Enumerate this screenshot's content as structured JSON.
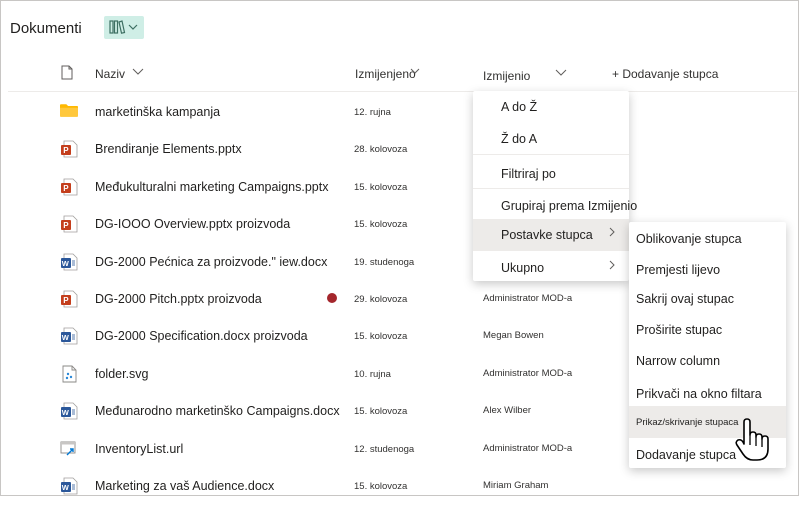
{
  "header": {
    "title": "Dokumenti"
  },
  "columns": {
    "name": "Naziv",
    "modified": "Izmijenjeno",
    "modified_by": "Izmijenio",
    "add_column": "+ Dodavanje stupca"
  },
  "rows": [
    {
      "name": "marketinška kampanja",
      "date": "12. rujna",
      "by": "",
      "icon": "folder-icon"
    },
    {
      "name": "Brendiranje Elements.pptx",
      "date": "28. kolovoza",
      "by": "",
      "icon": "powerpoint-icon"
    },
    {
      "name": "Međukulturalni marketing Campaigns.pptx",
      "date": "15. kolovoza",
      "by": "",
      "icon": "powerpoint-icon"
    },
    {
      "name": "DG-IOOO Overview.pptx proizvoda",
      "date": "15. kolovoza",
      "by": "",
      "icon": "powerpoint-icon"
    },
    {
      "name": "DG-2000 Pećnica za proizvode.\" iew.docx",
      "date": "19. studenoga",
      "by": "",
      "icon": "word-icon"
    },
    {
      "name": "DG-2000 Pitch.pptx proizvoda",
      "date": "29. kolovoza",
      "by": "Administrator MOD-a",
      "icon": "powerpoint-icon"
    },
    {
      "name": "DG-2000 Specification.docx proizvoda",
      "date": "15. kolovoza",
      "by": "Megan Bowen",
      "icon": "word-icon"
    },
    {
      "name": "folder.svg",
      "date": "10. rujna",
      "by": "Administrator MOD-a",
      "icon": "svg-file-icon"
    },
    {
      "name": "Međunarodno marketinško Campaigns.docx",
      "date": "15. kolovoza",
      "by": "Alex Wilber",
      "icon": "word-icon"
    },
    {
      "name": "InventoryList.url",
      "date": "12. studenoga",
      "by": "Administrator MOD-a",
      "icon": "url-file-icon"
    },
    {
      "name": "Marketing za vaš Audience.docx",
      "date": "15. kolovoza",
      "by": "Miriam Graham",
      "icon": "word-icon"
    }
  ],
  "column_menu": {
    "items": [
      "A do Ž",
      "Ž do A",
      "Filtriraj po",
      "Grupiraj prema Izmijenio",
      "Postavke stupca",
      "Ukupno"
    ]
  },
  "settings_submenu": {
    "items": [
      "Oblikovanje stupca",
      "Premjesti lijevo",
      "Sakrij ovaj stupac",
      "Proširite stupac",
      "Narrow column",
      "Prikvači na okno filtara",
      "Prikaz/skrivanje stupaca",
      "Dodavanje stupca"
    ]
  }
}
